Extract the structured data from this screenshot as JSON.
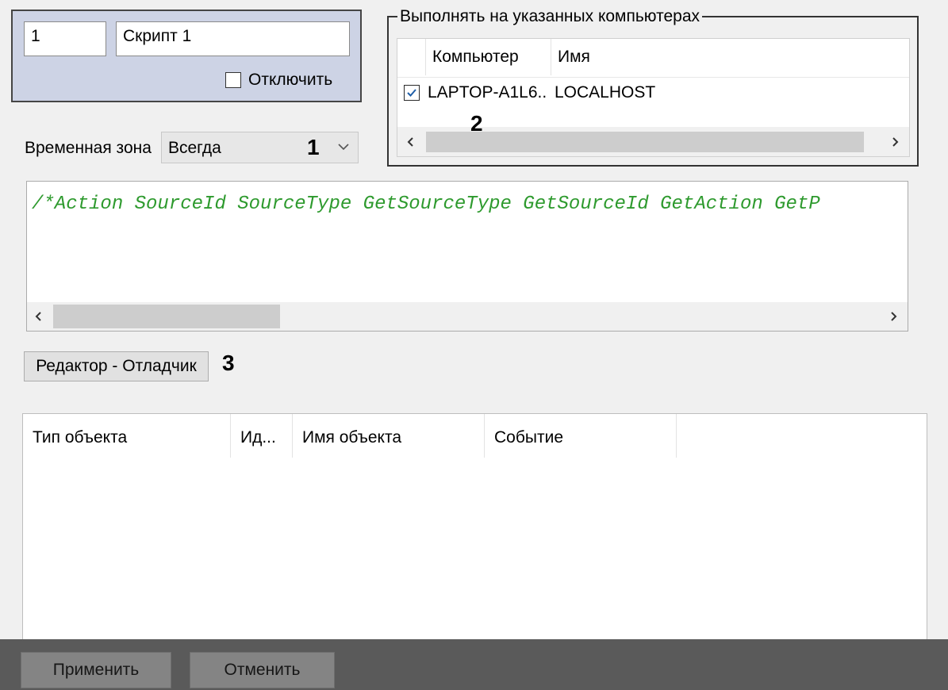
{
  "script": {
    "id_value": "1",
    "name_value": "Скрипт 1",
    "disable_label": "Отключить",
    "disable_checked": false
  },
  "time_zone": {
    "label": "Временная зона",
    "selected": "Всегда",
    "icon": "chevron-down-icon"
  },
  "callouts": {
    "one": "1",
    "two": "2",
    "three": "3"
  },
  "computers": {
    "group_title": "Выполнять на указанных компьютерах",
    "columns": [
      "Компьютер",
      "Имя"
    ],
    "rows": [
      {
        "checked": true,
        "computer": "LAPTOP-A1L6..",
        "name": "LOCALHOST"
      }
    ],
    "scroll_left_icon": "chevron-left-icon",
    "scroll_right_icon": "chevron-right-icon"
  },
  "editor": {
    "code": "/*Action SourceId SourceType GetSourceType GetSourceId GetAction GetP",
    "code_color": "#2e9a2e"
  },
  "debugger_button": {
    "label": "Редактор - Отладчик"
  },
  "events_table": {
    "columns": [
      "Тип объекта",
      "Ид...",
      "Имя объекта",
      "Событие"
    ]
  },
  "footer": {
    "apply_label": "Применить",
    "cancel_label": "Отменить"
  },
  "colors": {
    "panel_bg": "#cdd3e5",
    "window_bg": "#f0f0f0",
    "footer_bg": "#5a5a5a",
    "checkbox_check": "#1f5fa8"
  }
}
